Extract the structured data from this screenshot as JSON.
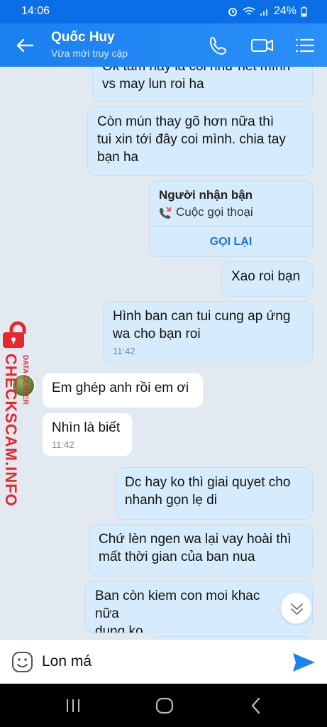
{
  "status_bar": {
    "time": "14:06",
    "battery": "24%"
  },
  "header": {
    "contact_name": "Quốc Huy",
    "presence": "Vừa mới truy cập"
  },
  "messages": [
    {
      "dir": "out",
      "text": "Ok tâm hay là coi như hết mình\nvs may lun roi ha"
    },
    {
      "dir": "out",
      "text": "Còn mún thay gõ hơn nữa thì\ntui xin tới đây coi mình. chia tay\nbạn ha"
    },
    {
      "dir": "out",
      "text": "Xao roi bạn"
    },
    {
      "dir": "out",
      "text": "Hình ban can tui cung ap ứng\nwa cho bạn roi",
      "time": "11:42"
    },
    {
      "dir": "in",
      "text": "Em ghép anh rồi em ơi"
    },
    {
      "dir": "in",
      "text": "Nhìn là biết",
      "time": "11:42"
    },
    {
      "dir": "out",
      "text": "Dc hay ko thì giai quyet cho\nnhanh gọn lẹ di"
    },
    {
      "dir": "out",
      "text": "Chứ lèn ngen wa lại vay hoài thì\nmất thời gian của ban nua"
    },
    {
      "dir": "out",
      "text": "Ban còn kiem con moi khac nữa\ndung ko"
    }
  ],
  "call_card": {
    "title": "Người nhận bận",
    "subtitle": "Cuộc gọi thoại",
    "action": "GỌI LẠI"
  },
  "watermark": {
    "text": "CHECKSCAM.INFO",
    "sub": "DATA CENTER"
  },
  "composer": {
    "value": "Lon má"
  },
  "colors": {
    "header": "#1b80f0",
    "outgoing": "#d6ecfc",
    "incoming": "#ffffff",
    "accent": "#1a72e4"
  },
  "icons": [
    "back-arrow-icon",
    "phone-icon",
    "video-call-icon",
    "menu-list-icon",
    "missed-call-icon",
    "scroll-down-icon",
    "emoji-icon",
    "send-icon"
  ]
}
